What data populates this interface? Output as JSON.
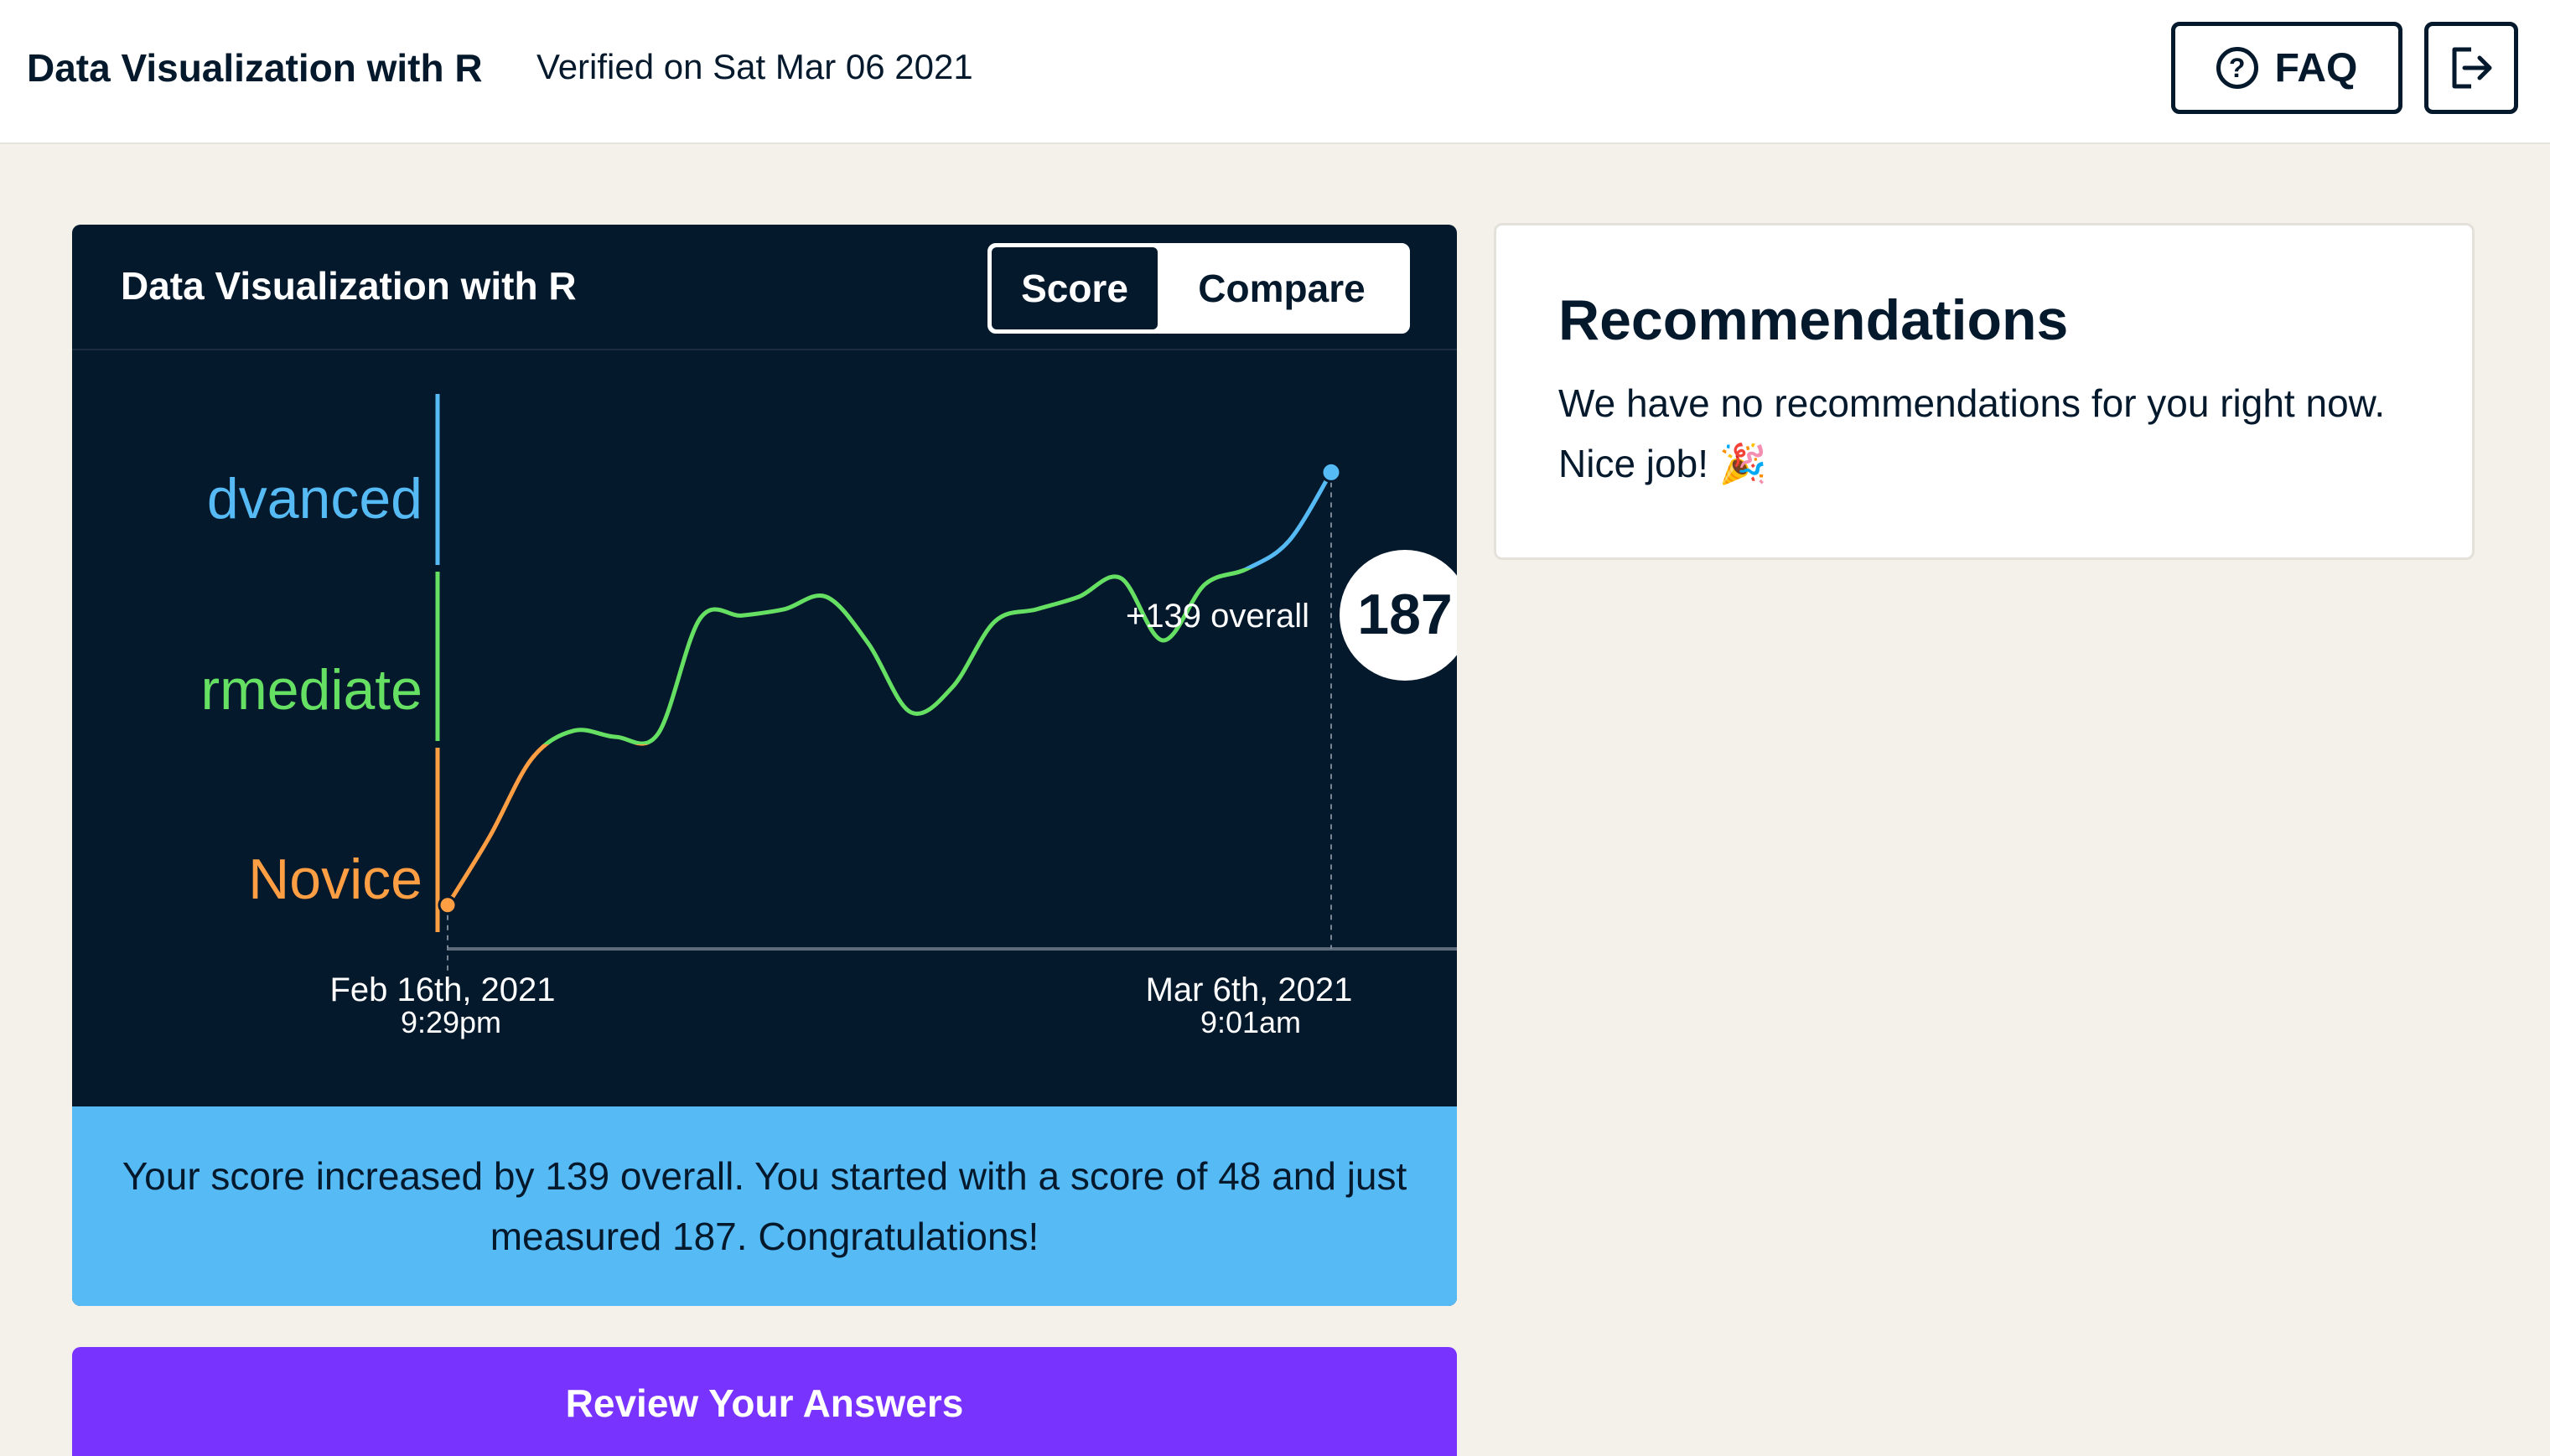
{
  "header": {
    "title": "Data Visualization with R",
    "verified": "Verified on Sat Mar 06 2021",
    "faq_label": "FAQ"
  },
  "card": {
    "title": "Data Visualization with R",
    "toggle": {
      "score_label": "Score",
      "compare_label": "Compare",
      "selected": "Score"
    }
  },
  "chart_data": {
    "type": "line",
    "title": "",
    "levels": [
      {
        "label": "Advanced",
        "visible_text": "dvanced",
        "color": "#56baf5"
      },
      {
        "label": "Intermediate",
        "visible_text": "rmediate",
        "color": "#66e063"
      },
      {
        "label": "Novice",
        "visible_text": "Novice",
        "color": "#ff9e42"
      }
    ],
    "series": [
      {
        "values": [
          48,
          70,
          95,
          104,
          102,
          103,
          140,
          141,
          143,
          147,
          132,
          110,
          118,
          139,
          143,
          147,
          153,
          133,
          151,
          156,
          165,
          187
        ]
      }
    ],
    "ylim": [
      0,
      210
    ],
    "start": {
      "date": "Feb 16th, 2021",
      "time": "9:29pm",
      "score": 48
    },
    "end": {
      "date": "Mar 6th, 2021",
      "time": "9:01am",
      "score": 187
    },
    "change_label": "+139 overall",
    "current_score": "187"
  },
  "banner": {
    "text": "Your score increased by 139 overall. You started with a score of 48 and just measured 187. Congratulations!"
  },
  "review_button": {
    "label": "Review Your Answers"
  },
  "recommendations": {
    "title": "Recommendations",
    "text": "We have no recommendations for you right now. Nice job!",
    "emoji": "🎉"
  }
}
